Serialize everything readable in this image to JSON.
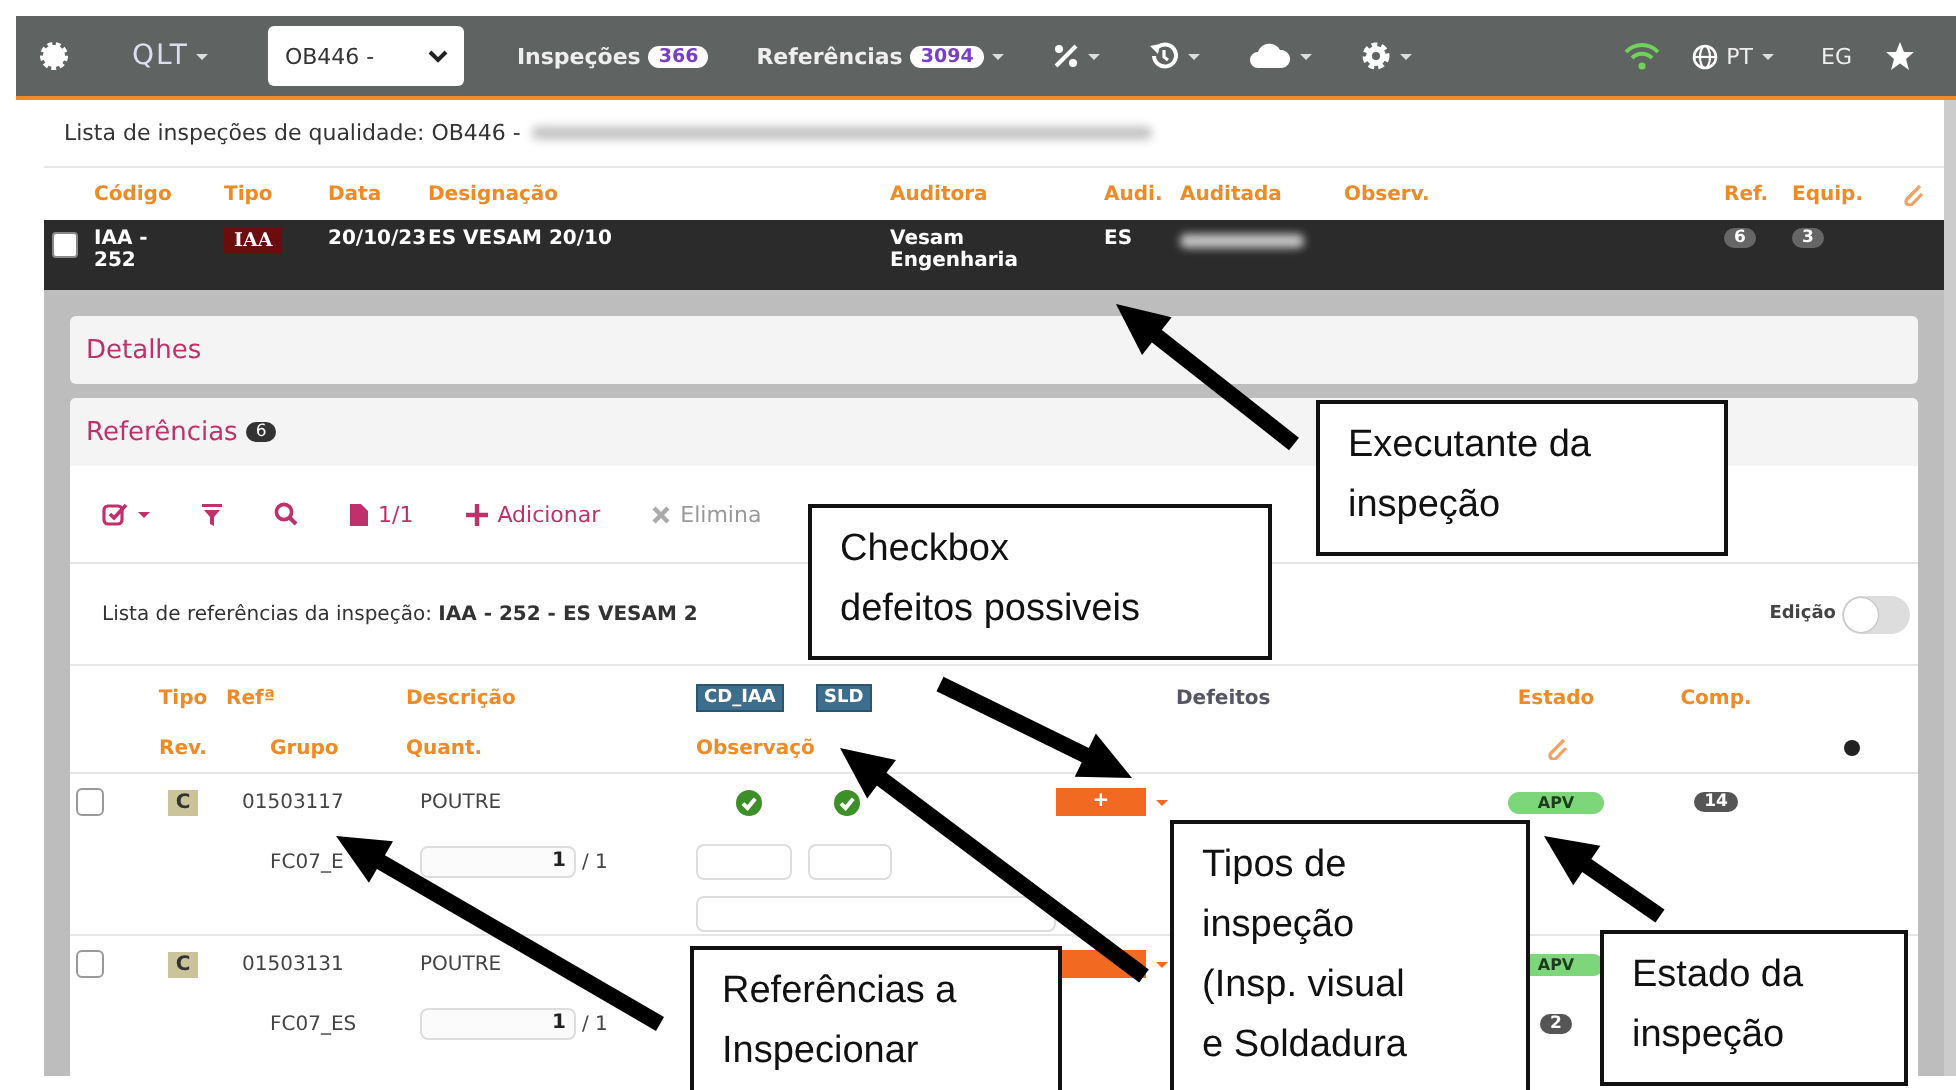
{
  "nav": {
    "app": "QLT",
    "project": "OB446 -",
    "links": [
      {
        "label": "Inspeções",
        "count": "366",
        "caret": false
      },
      {
        "label": "Referências",
        "count": "3094",
        "caret": true
      }
    ],
    "language": "PT",
    "user": "EG"
  },
  "inspections": {
    "title": "Lista de inspeções de qualidade: OB446 -",
    "columns": [
      "Código",
      "Tipo",
      "Data",
      "Designação",
      "Auditora",
      "Audi.",
      "Auditada",
      "Observ.",
      "Ref.",
      "Equip."
    ],
    "rows": [
      {
        "selected": true,
        "checked": false,
        "code": "IAA - 252",
        "type": "IAA",
        "date": "20/10/23",
        "designation": "ES VESAM 20/10",
        "auditor": "Vesam Engenharia",
        "audi": "ES",
        "refs": "6",
        "equip": "3"
      }
    ]
  },
  "details": {
    "title": "Detalhes"
  },
  "references": {
    "title": "Referências",
    "count": "6",
    "toolbar": {
      "pages": "1/1",
      "add": "Adicionar",
      "delete": "Elimina"
    },
    "list_title": "Lista de referências da inspeção: **IAA - 252 - ES VESAM 2**",
    "edit_toggle": {
      "label": "Edição",
      "on": false
    },
    "columns": {
      "type": "Tipo",
      "revision": "Rev.",
      "ref": "Refª",
      "group": "Grupo",
      "description": "Descrição",
      "quantity": "Quant.",
      "inspection_types": [
        "CD_IAA",
        "SLD"
      ],
      "observations": "Observaçõ",
      "defects": "Defeitos",
      "state": "Estado",
      "comp": "Comp."
    },
    "rows": [
      {
        "checked": false,
        "revision": "C",
        "ref": "01503117",
        "description": "POUTRE",
        "group": "FC07_E",
        "quantity": "1",
        "total": "/ 1",
        "checks": [
          true,
          true
        ],
        "defect_label": "+",
        "state": "APV",
        "comp": "14"
      },
      {
        "checked": false,
        "revision": "C",
        "ref": "01503131",
        "description": "POUTRE",
        "group": "FC07_ES",
        "quantity": "1",
        "total": "/ 1",
        "state": "APV",
        "count": "2"
      }
    ]
  },
  "annotations": [
    {
      "text": "Executante da\ninspeção"
    },
    {
      "text": "Checkbox\ndefeitos possiveis"
    },
    {
      "text": "Referências a\nInspecionar"
    },
    {
      "text": "Tipos de\ninspeção\n(Insp. visual\ne Soldadura"
    },
    {
      "text": "Estado da\ninspeção"
    }
  ]
}
